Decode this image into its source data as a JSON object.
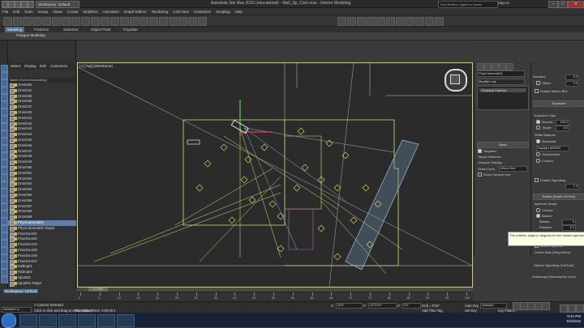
{
  "title": {
    "workspace": "Workspace: Default",
    "text": "Autodesk 3ds Max 2016 (educational) - Mall_Sp_Cam.max - Interior Modeling",
    "search_placeholder": "Find Reflect Lights for Scene",
    "user": "Sign In"
  },
  "menu": [
    "File",
    "Edit",
    "Tools",
    "Group",
    "Views",
    "Create",
    "Modifiers",
    "Animation",
    "Graph Editors",
    "Rendering",
    "Civil View",
    "Customize",
    "Scripting",
    "Help"
  ],
  "ribbon": {
    "tabs": [
      "Modeling",
      "Freeform",
      "Selection",
      "Object Paint",
      "Populate"
    ],
    "poly_label": "Polygon Modeling"
  },
  "explorer": {
    "menu": [
      "Select",
      "Display",
      "Edit",
      "Customize"
    ],
    "header": "Name (Sorted Ascending)",
    "items": [
      "Omni032",
      "Omni034",
      "Omni035",
      "Omni036",
      "Omni037",
      "Omni040",
      "Omni041",
      "Omni042",
      "Omni043",
      "Omni044",
      "Omni045",
      "Omni046",
      "Omni047",
      "Omni048",
      "Omni049",
      "Omni050",
      "Omni051",
      "Omni052",
      "Omni053",
      "Omni054",
      "Omni055",
      "Omni056",
      "Omni057",
      "Omni058",
      "Omni059",
      "PhysCamera001",
      "PhysCamera001.Target",
      "FloorDoor01",
      "FloorDoor02",
      "FloorDoor03",
      "FloorDoor05",
      "FloorDoor06",
      "FloorDoor07",
      "Railing01",
      "Railing02",
      "Spot001",
      "Spot001.Target",
      "Spot002",
      "Spot002.Target",
      "Spot003"
    ],
    "selected_index": 25
  },
  "viewport": {
    "label": "[+] [Top] [Wireframe]"
  },
  "command_panel": {
    "object_name": "PhysCamera001",
    "modifier_list": "Modifier List",
    "stack_item": "Physical Camera",
    "rollout_basic": "Basic",
    "targeted_label": "Targeted",
    "target_distance_label": "Target Distance:",
    "viewport_display_label": "Viewport Display",
    "show_cone_label": "Show Cone:",
    "show_cone_value": "When Sele",
    "show_horizon_label": "Show Horizon Line"
  },
  "params": {
    "duration_label": "Duration:",
    "duration_value": "0.5",
    "offset_label": "Offset:",
    "offset_value": "0.0",
    "enable_motion_blur": "Enable Motion Blur",
    "exposure_rollout": "Exposure",
    "exposure_gain": "Exposure Gain",
    "manual_label": "Manual:",
    "manual_value": "200.0",
    "target_label": "Target:",
    "target_value": "6.0",
    "white_balance": "White Balance",
    "illuminant_label": "Illuminant",
    "illuminant_value": "Daylight (6500K)",
    "temperature_label": "Temperature",
    "custom_label": "Custom",
    "vignetting_label": "Enable Vignetting",
    "vignetting_amount": "1.0",
    "bokeh_rollout": "Bokeh (Depth of Field)",
    "aperture_shape": "Aperture Shape",
    "circular": "Circular",
    "bladed": "Bladed",
    "blades_label": "Blades:",
    "blades_value": "5",
    "rotation_label": "Rotation:",
    "rotation_value": "0.0",
    "affect_exposure": "Affect Exposure",
    "center_bias": "Center Bias (Ring Effect)",
    "optical_vignetting": "Optical Vignetting (Cat Eye)",
    "anisotropy": "Anisotropy (Anamorphic Lens)",
    "tooltip": "The rotation angle in degrees for the bladed aperture"
  },
  "timeline": {
    "position": "0 / 100",
    "ticks": [
      "0",
      "5",
      "10",
      "15",
      "20",
      "25",
      "30",
      "35",
      "40",
      "45",
      "50",
      "55",
      "60",
      "65",
      "70",
      "75",
      "80",
      "85",
      "90",
      "95",
      "100"
    ]
  },
  "status": {
    "selected": "1 Camera Selected",
    "prompt": "Click or click-and-drag to select objects",
    "script": "Selection Ic ...",
    "translation": "Translation Time: 0:00:00:1",
    "x_label": "X:",
    "x_value": "34'9\"",
    "y_label": "Y:",
    "y_value": "1273'10\"",
    "z_label": "Z:",
    "z_value": "0'0\"",
    "grid": "Grid = 0'10\"",
    "add_time_tag": "Add Time Tag",
    "auto_key": "Auto Key",
    "selected_key": "Selected",
    "set_key": "Set Key",
    "key_filters": "Key Filters..."
  },
  "workspace_badge": "Workspace: Default",
  "taskbar": {
    "time": "9:44 PM",
    "date": "6/4/2016"
  },
  "colors": {
    "viewport_border": "#d8d060",
    "selection": "#5a7fb0",
    "wire_yellow": "#e0e070",
    "wire_cyan": "#80c0d0",
    "wire_magenta": "#c060c0"
  }
}
